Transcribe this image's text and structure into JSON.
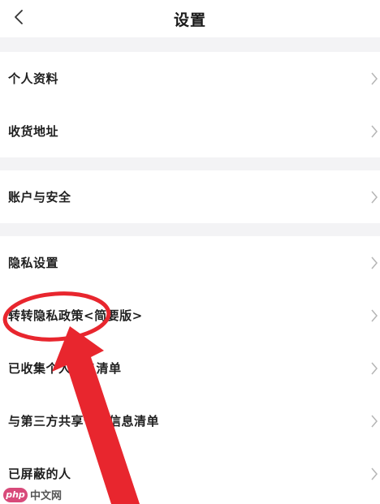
{
  "header": {
    "title": "设置",
    "back_icon": "chevron-left-icon"
  },
  "groups": [
    {
      "items": [
        {
          "label": "个人资料"
        },
        {
          "label": "收货地址"
        }
      ]
    },
    {
      "items": [
        {
          "label": "账户与安全"
        }
      ]
    },
    {
      "items": [
        {
          "label": "隐私设置"
        },
        {
          "label": "转转隐私政策<简要版>"
        },
        {
          "label": "已收集个人信息清单"
        },
        {
          "label": "与第三方共享个人信息清单"
        },
        {
          "label": "已屏蔽的人"
        }
      ]
    }
  ],
  "annotation": {
    "circle_color": "#e8262e",
    "arrow_color": "#e8262e",
    "target": "转转隐私政策<简要版>"
  },
  "watermark": {
    "logo_text": "php",
    "text": "中文网"
  }
}
